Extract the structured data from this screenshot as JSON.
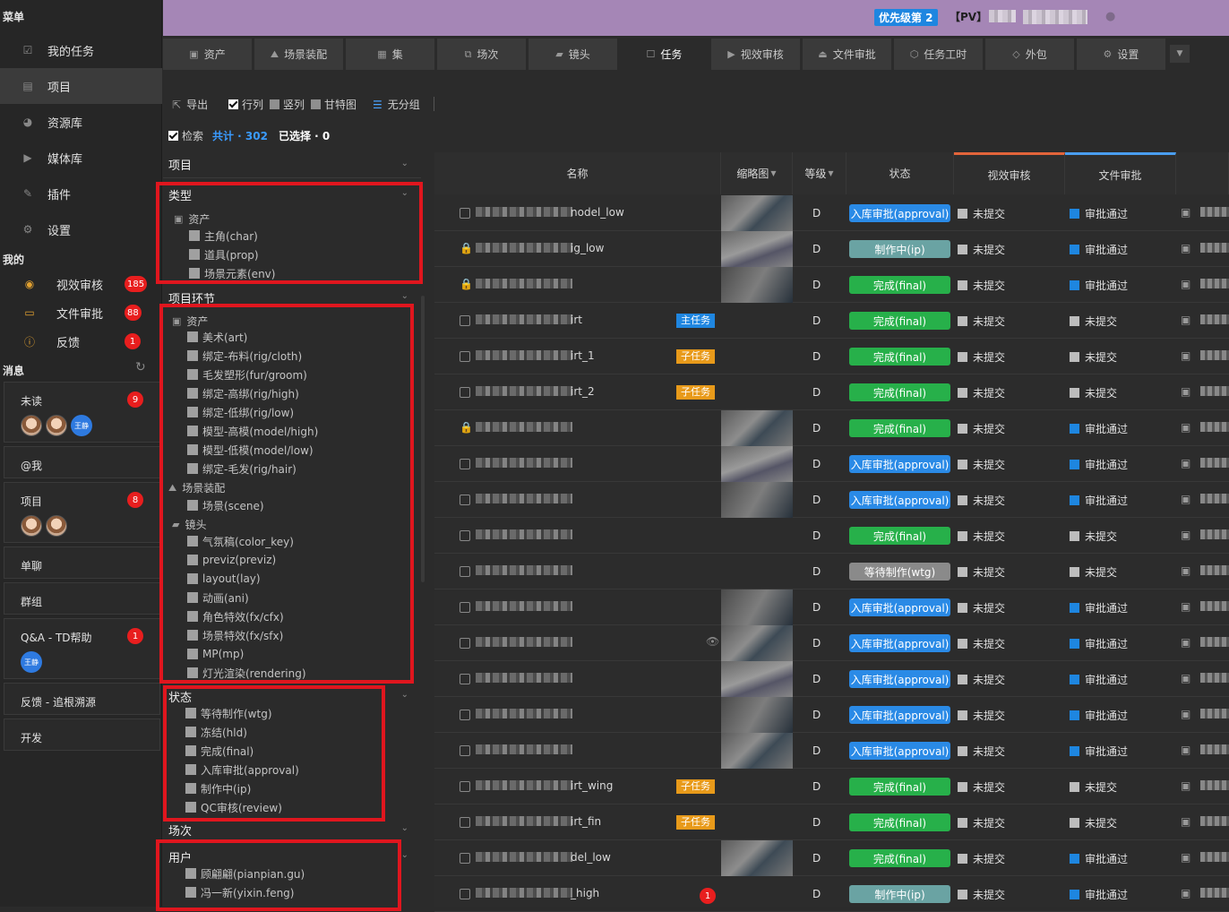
{
  "menu_title": "菜单",
  "nav": [
    {
      "label": "我的任务",
      "icon": "checklist-icon"
    },
    {
      "label": "项目",
      "icon": "project-icon"
    },
    {
      "label": "资源库",
      "icon": "library-icon"
    },
    {
      "label": "媒体库",
      "icon": "media-icon"
    },
    {
      "label": "插件",
      "icon": "plugin-icon"
    },
    {
      "label": "设置",
      "icon": "gear-icon"
    }
  ],
  "mine_title": "我的",
  "mine": [
    {
      "label": "视效审核",
      "count": "185",
      "icon": "eye-icon"
    },
    {
      "label": "文件审批",
      "count": "88",
      "icon": "folder-icon"
    },
    {
      "label": "反馈",
      "count": "1",
      "icon": "alert-icon"
    }
  ],
  "messages_title": "消息",
  "messages": [
    {
      "label": "未读",
      "count": "9",
      "avatar_text": "王静"
    },
    {
      "label": "@我"
    },
    {
      "label": "项目",
      "count": "8"
    },
    {
      "label": "单聊"
    },
    {
      "label": "群组"
    },
    {
      "label": "Q&A - TD帮助",
      "count": "1",
      "avatar_text": "王静"
    },
    {
      "label": "反馈 - 追根溯源"
    },
    {
      "label": "开发"
    }
  ],
  "top": {
    "priority": "优先级第 2",
    "pv": "【PV】"
  },
  "tabs": [
    {
      "label": "资产",
      "icon": "asset-icon"
    },
    {
      "label": "场景装配",
      "icon": "scene-icon"
    },
    {
      "label": "集",
      "icon": "episode-icon"
    },
    {
      "label": "场次",
      "icon": "sequence-icon"
    },
    {
      "label": "镜头",
      "icon": "shot-icon"
    },
    {
      "label": "任务",
      "icon": "task-icon"
    },
    {
      "label": "视效审核",
      "icon": "review-icon"
    },
    {
      "label": "文件审批",
      "icon": "approve-icon"
    },
    {
      "label": "任务工时",
      "icon": "clock-icon"
    },
    {
      "label": "外包",
      "icon": "outsource-icon"
    },
    {
      "label": "设置",
      "icon": "gear-icon"
    }
  ],
  "toolbar": {
    "export": "导出",
    "row": "行列",
    "col": "竖列",
    "gantt": "甘特图",
    "group": "无分组",
    "search": "检索",
    "total": "共计 · 302",
    "selected": "已选择 · 0"
  },
  "filter": {
    "project": "项目",
    "type": "类型",
    "type_group": "资产",
    "type_items": [
      "主角(char)",
      "道具(prop)",
      "场景元素(env)"
    ],
    "step": "项目环节",
    "step_asset": "资产",
    "step_asset_items": [
      "美术(art)",
      "绑定-布料(rig/cloth)",
      "毛发塑形(fur/groom)",
      "绑定-高绑(rig/high)",
      "绑定-低绑(rig/low)",
      "模型-高模(model/high)",
      "模型-低模(model/low)",
      "绑定-毛发(rig/hair)"
    ],
    "step_scene": "场景装配",
    "step_scene_items": [
      "场景(scene)"
    ],
    "step_shot": "镜头",
    "step_shot_items": [
      "气氛稿(color_key)",
      "previz(previz)",
      "layout(lay)",
      "动画(ani)",
      "角色特效(fx/cfx)",
      "场景特效(fx/sfx)",
      "MP(mp)",
      "灯光渲染(rendering)"
    ],
    "status": "状态",
    "status_items": [
      "等待制作(wtg)",
      "冻结(hld)",
      "完成(final)",
      "入库审批(approval)",
      "制作中(ip)",
      "QC审核(review)"
    ],
    "sequence": "场次",
    "user": "用户",
    "user_items": [
      "顾翩翩(pianpian.gu)",
      "冯一新(yixin.feng)"
    ]
  },
  "columns": {
    "name": "名称",
    "thumb": "缩略图",
    "level": "等级",
    "status": "状态",
    "vfx": "视效审核",
    "file": "文件审批"
  },
  "colors": {
    "approval": "#2a8ae6",
    "ip": "#6aa3a3",
    "final": "#27b04a",
    "wtg": "#8a8a8a",
    "main_tag": "#1f86e0",
    "sub_tag": "#e89a1a",
    "highlight": "#e0161e"
  },
  "rows": [
    {
      "lock": false,
      "suffix": "nodel_low",
      "tag": "",
      "level": "D",
      "status": "入库审批(approval)",
      "st": "approval",
      "vfx": "未提交",
      "file": "审批通过",
      "fileok": true,
      "thumb": true
    },
    {
      "lock": true,
      "suffix": "ig_low",
      "tag": "",
      "level": "D",
      "status": "制作中(ip)",
      "st": "ip",
      "vfx": "未提交",
      "file": "审批通过",
      "fileok": true,
      "thumb": true
    },
    {
      "lock": true,
      "suffix": "",
      "tag": "",
      "level": "D",
      "status": "完成(final)",
      "st": "final",
      "vfx": "未提交",
      "file": "审批通过",
      "fileok": true,
      "thumb": true
    },
    {
      "lock": false,
      "suffix": "irt",
      "tag": "主任务",
      "tagtype": "main",
      "level": "D",
      "status": "完成(final)",
      "st": "final",
      "vfx": "未提交",
      "file": "未提交",
      "fileok": false,
      "thumb": false
    },
    {
      "lock": false,
      "suffix": "irt_1",
      "tag": "子任务",
      "tagtype": "sub",
      "level": "D",
      "status": "完成(final)",
      "st": "final",
      "vfx": "未提交",
      "file": "未提交",
      "fileok": false,
      "thumb": false
    },
    {
      "lock": false,
      "suffix": "irt_2",
      "tag": "子任务",
      "tagtype": "sub",
      "level": "D",
      "status": "完成(final)",
      "st": "final",
      "vfx": "未提交",
      "file": "未提交",
      "fileok": false,
      "thumb": false
    },
    {
      "lock": true,
      "suffix": "",
      "tag": "",
      "level": "D",
      "status": "完成(final)",
      "st": "final",
      "vfx": "未提交",
      "file": "审批通过",
      "fileok": true,
      "thumb": true
    },
    {
      "lock": false,
      "suffix": "",
      "tag": "",
      "level": "D",
      "status": "入库审批(approval)",
      "st": "approval",
      "vfx": "未提交",
      "file": "审批通过",
      "fileok": true,
      "thumb": true
    },
    {
      "lock": false,
      "suffix": "",
      "tag": "",
      "level": "D",
      "status": "入库审批(approval)",
      "st": "approval",
      "vfx": "未提交",
      "file": "审批通过",
      "fileok": true,
      "thumb": true
    },
    {
      "lock": false,
      "suffix": "",
      "tag": "",
      "level": "D",
      "status": "完成(final)",
      "st": "final",
      "vfx": "未提交",
      "file": "未提交",
      "fileok": false,
      "thumb": false
    },
    {
      "lock": false,
      "suffix": "",
      "tag": "",
      "level": "D",
      "status": "等待制作(wtg)",
      "st": "wtg",
      "vfx": "未提交",
      "file": "未提交",
      "fileok": false,
      "thumb": false
    },
    {
      "lock": false,
      "suffix": "",
      "tag": "",
      "level": "D",
      "status": "入库审批(approval)",
      "st": "approval",
      "vfx": "未提交",
      "file": "审批通过",
      "fileok": true,
      "thumb": true
    },
    {
      "lock": false,
      "suffix": "",
      "tag": "",
      "level": "D",
      "status": "入库审批(approval)",
      "st": "approval",
      "vfx": "未提交",
      "file": "审批通过",
      "fileok": true,
      "thumb": true,
      "eye": true
    },
    {
      "lock": false,
      "suffix": "",
      "tag": "",
      "level": "D",
      "status": "入库审批(approval)",
      "st": "approval",
      "vfx": "未提交",
      "file": "审批通过",
      "fileok": true,
      "thumb": true
    },
    {
      "lock": false,
      "suffix": "",
      "tag": "",
      "level": "D",
      "status": "入库审批(approval)",
      "st": "approval",
      "vfx": "未提交",
      "file": "审批通过",
      "fileok": true,
      "thumb": true
    },
    {
      "lock": false,
      "suffix": "",
      "tag": "",
      "level": "D",
      "status": "入库审批(approval)",
      "st": "approval",
      "vfx": "未提交",
      "file": "审批通过",
      "fileok": true,
      "thumb": true
    },
    {
      "lock": false,
      "suffix": "irt_wing",
      "tag": "子任务",
      "tagtype": "sub",
      "level": "D",
      "status": "完成(final)",
      "st": "final",
      "vfx": "未提交",
      "file": "未提交",
      "fileok": false,
      "thumb": false
    },
    {
      "lock": false,
      "suffix": "irt_fin",
      "tag": "子任务",
      "tagtype": "sub",
      "level": "D",
      "status": "完成(final)",
      "st": "final",
      "vfx": "未提交",
      "file": "未提交",
      "fileok": false,
      "thumb": false
    },
    {
      "lock": false,
      "suffix": "del_low",
      "tag": "",
      "level": "D",
      "status": "完成(final)",
      "st": "final",
      "vfx": "未提交",
      "file": "审批通过",
      "fileok": true,
      "thumb": true
    },
    {
      "lock": false,
      "suffix": "_high",
      "tag": "",
      "level": "D",
      "status": "制作中(ip)",
      "st": "ip",
      "vfx": "未提交",
      "file": "审批通过",
      "fileok": true,
      "thumb": false,
      "badge": "1"
    }
  ]
}
